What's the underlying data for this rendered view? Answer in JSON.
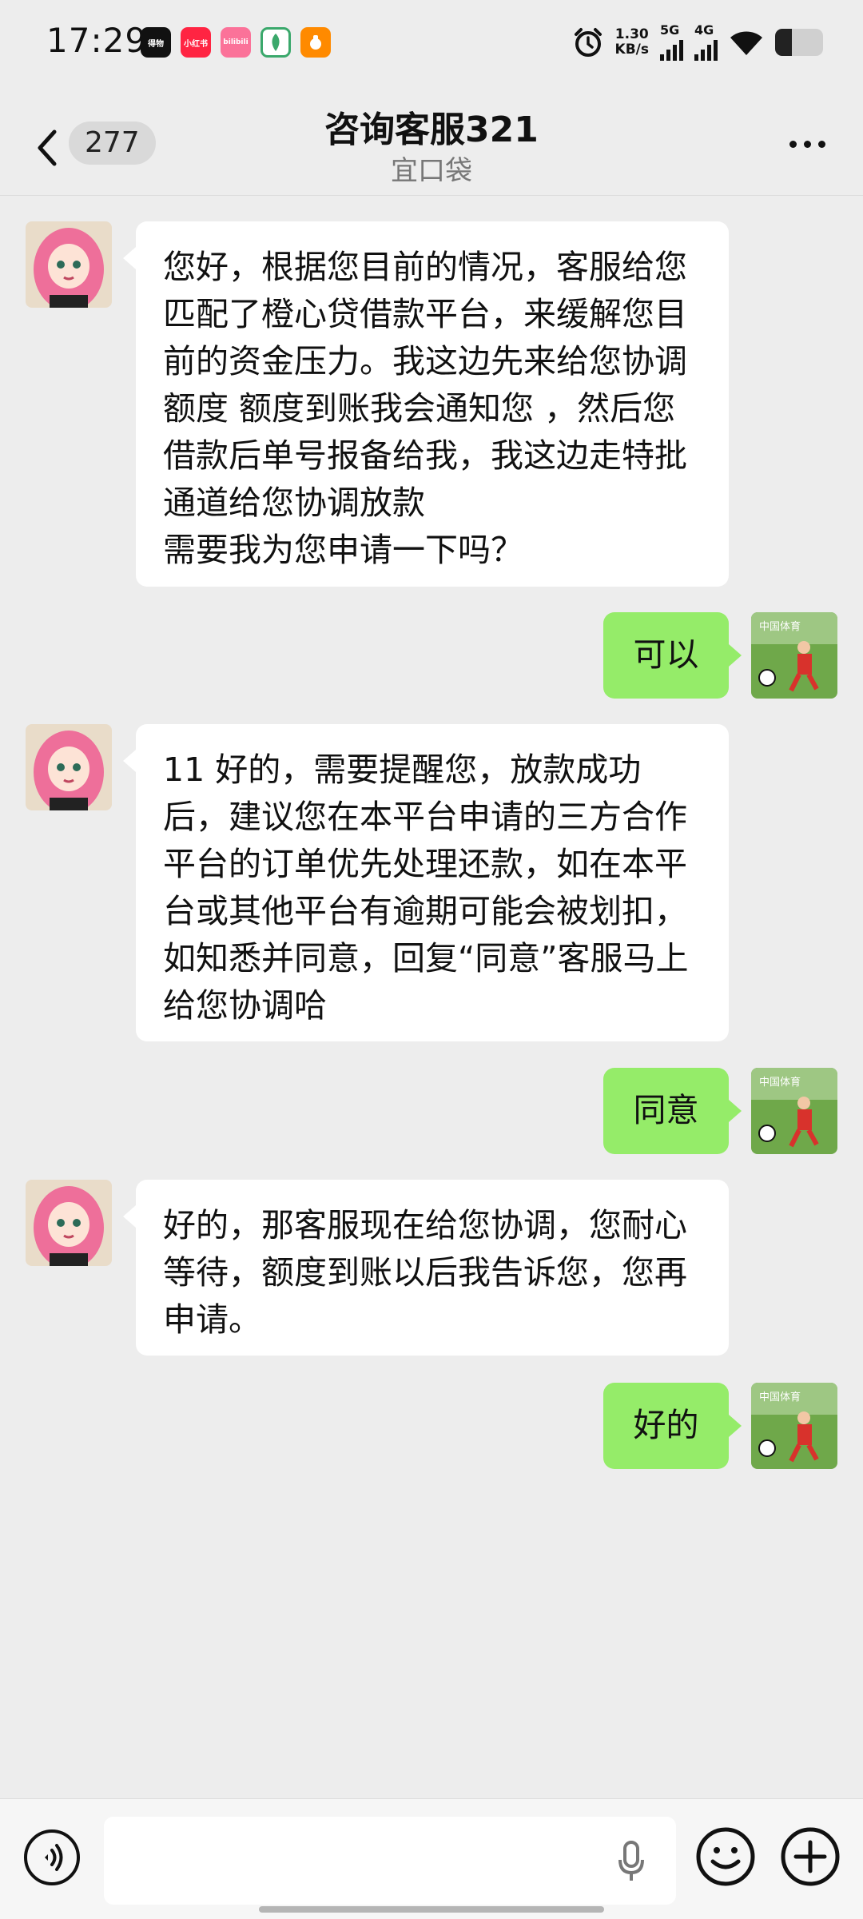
{
  "status_bar": {
    "time": "17:29",
    "net_speed_value": "1.30",
    "net_speed_unit": "KB/s",
    "net1": "5G",
    "net2": "4G",
    "battery_level": 0.35,
    "apps": [
      "得物",
      "小红书",
      "bilibili",
      "app-icon",
      "app-icon"
    ]
  },
  "header": {
    "unread_count": "277",
    "title": "咨询客服321",
    "subtitle": "宜口袋"
  },
  "messages": [
    {
      "side": "in",
      "text": "您好，根据您目前的情况，客服给您匹配了橙心贷借款平台，来缓解您目前的资金压力。我这边先来给您协调额度 额度到账我会通知您 ，然后您借款后单号报备给我，我这边走特批通道给您协调放款\n需要我为您申请一下吗？"
    },
    {
      "side": "out",
      "text": "可以"
    },
    {
      "side": "in",
      "text": "11 好的，需要提醒您，放款成功后，建议您在本平台申请的三方合作平台的订单优先处理还款，如在本平台或其他平台有逾期可能会被划扣，如知悉并同意，回复“同意”客服马上给您协调哈"
    },
    {
      "side": "out",
      "text": "同意"
    },
    {
      "side": "in",
      "text": "好的，那客服现在给您协调，您耐心等待，额度到账以后我告诉您，您再申请。"
    },
    {
      "side": "out",
      "text": "好的"
    }
  ],
  "input": {
    "placeholder": ""
  },
  "colors": {
    "bubble_out": "#95ec69",
    "bubble_in": "#ffffff",
    "background": "#ededed"
  }
}
